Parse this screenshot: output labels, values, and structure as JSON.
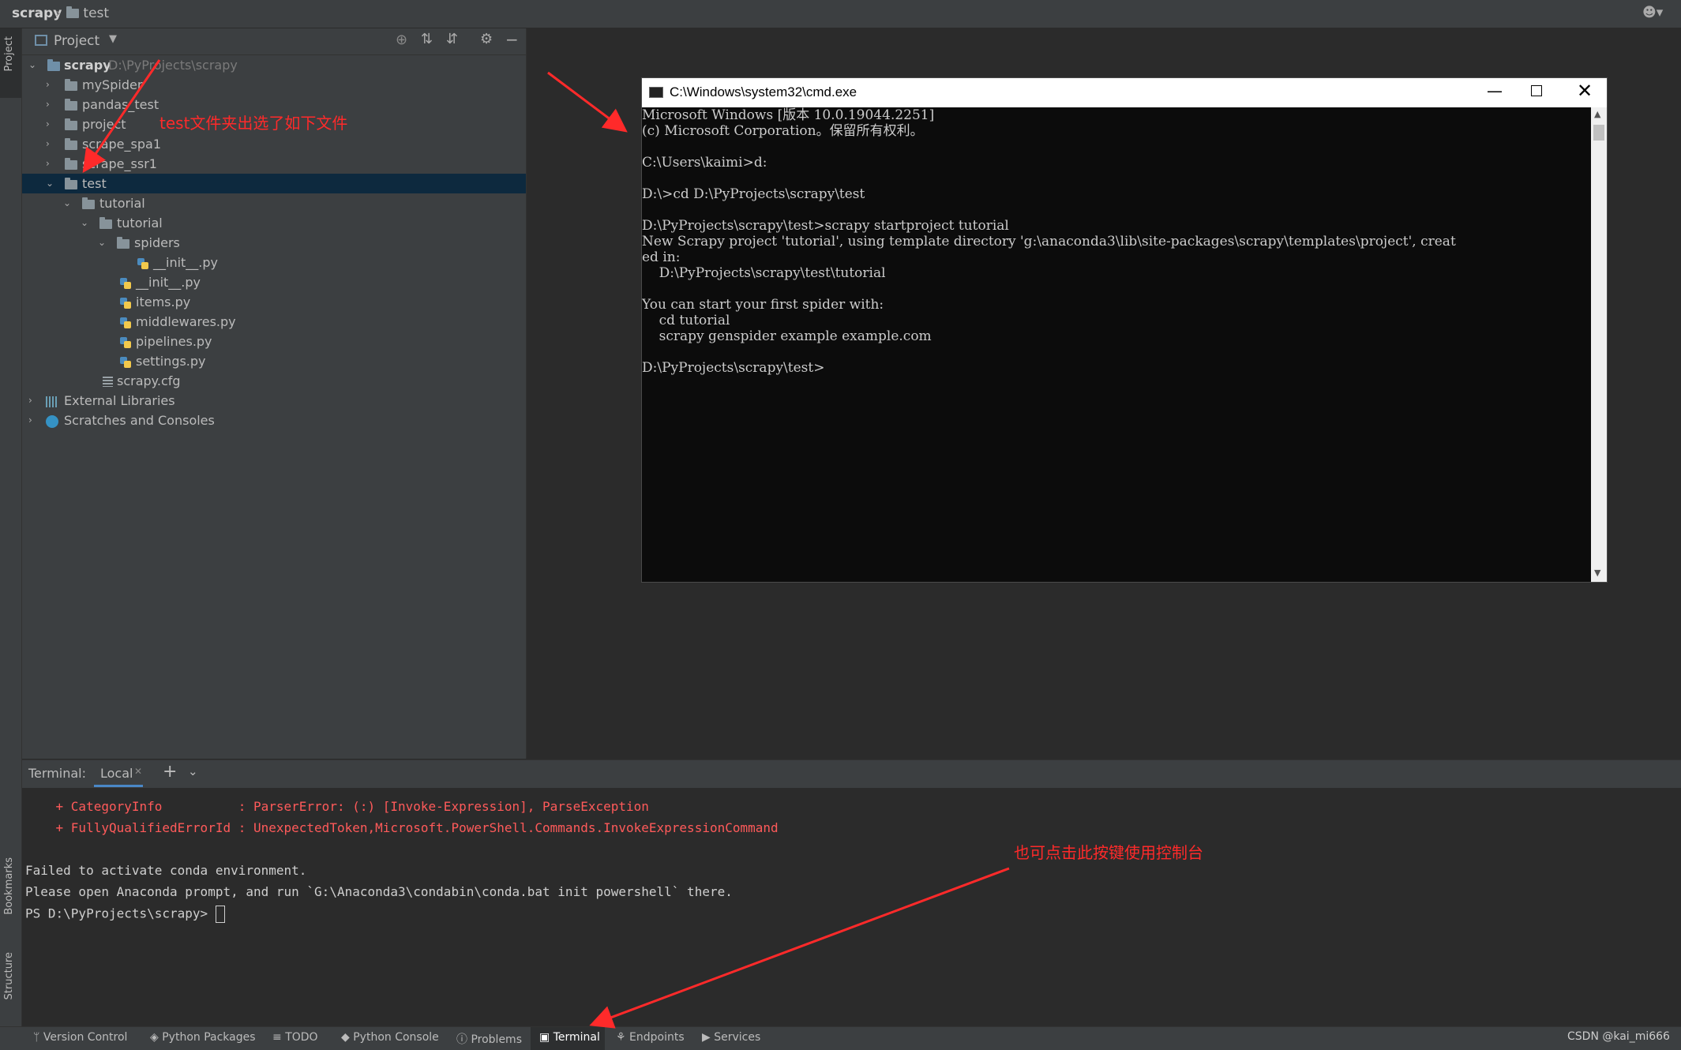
{
  "breadcrumb": {
    "root": "scrapy",
    "folder": "test"
  },
  "left_strip": {
    "project_tab": "Project",
    "bookmarks_tab": "Bookmarks",
    "structure_tab": "Structure"
  },
  "project_panel": {
    "title": "Project",
    "tree": [
      {
        "label": "scrapy",
        "path": "D:\\PyProjects\\scrapy"
      },
      {
        "label": "mySpider"
      },
      {
        "label": "pandas_test"
      },
      {
        "label": "project"
      },
      {
        "label": "scrape_spa1"
      },
      {
        "label": "scrape_ssr1"
      },
      {
        "label": "test"
      },
      {
        "label": "tutorial"
      },
      {
        "label": "tutorial"
      },
      {
        "label": "spiders"
      },
      {
        "label": "__init__.py"
      },
      {
        "label": "__init__.py"
      },
      {
        "label": "items.py"
      },
      {
        "label": "middlewares.py"
      },
      {
        "label": "pipelines.py"
      },
      {
        "label": "settings.py"
      },
      {
        "label": "scrapy.cfg"
      },
      {
        "label": "External Libraries"
      },
      {
        "label": "Scratches and Consoles"
      }
    ]
  },
  "annotations": {
    "tree_note": "test文件夹出选了如下文件",
    "terminal_note": "也可点击此按键使用控制台"
  },
  "cmd_window": {
    "title": "C:\\Windows\\system32\\cmd.exe",
    "lines": [
      "Microsoft Windows [版本 10.0.19044.2251]",
      "(c) Microsoft Corporation。保留所有权利。",
      "",
      "C:\\Users\\kaimi>d:",
      "",
      "D:\\>cd D:\\PyProjects\\scrapy\\test",
      "",
      "D:\\PyProjects\\scrapy\\test>scrapy startproject tutorial",
      "New Scrapy project 'tutorial', using template directory 'g:\\anaconda3\\lib\\site-packages\\scrapy\\templates\\project', creat",
      "ed in:",
      "    D:\\PyProjects\\scrapy\\test\\tutorial",
      "",
      "You can start your first spider with:",
      "    cd tutorial",
      "    scrapy genspider example example.com",
      "",
      "D:\\PyProjects\\scrapy\\test>"
    ]
  },
  "terminal": {
    "label": "Terminal:",
    "tab": "Local",
    "lines": [
      {
        "text": "    + CategoryInfo          : ParserError: (:) [Invoke-Expression], ParseException",
        "color": "red"
      },
      {
        "text": "    + FullyQualifiedErrorId : UnexpectedToken,Microsoft.PowerShell.Commands.InvokeExpressionCommand",
        "color": "red"
      },
      {
        "text": "",
        "color": "white"
      },
      {
        "text": "Failed to activate conda environment.",
        "color": "white"
      },
      {
        "text": "Please open Anaconda prompt, and run `G:\\Anaconda3\\condabin\\conda.bat init powershell` there.",
        "color": "white"
      },
      {
        "text": "PS D:\\PyProjects\\scrapy> ",
        "color": "white"
      }
    ]
  },
  "bottom_tabs": [
    "Version Control",
    "Python Packages",
    "TODO",
    "Python Console",
    "Problems",
    "Terminal",
    "Endpoints",
    "Services"
  ],
  "watermark": "CSDN @kai_mi666"
}
